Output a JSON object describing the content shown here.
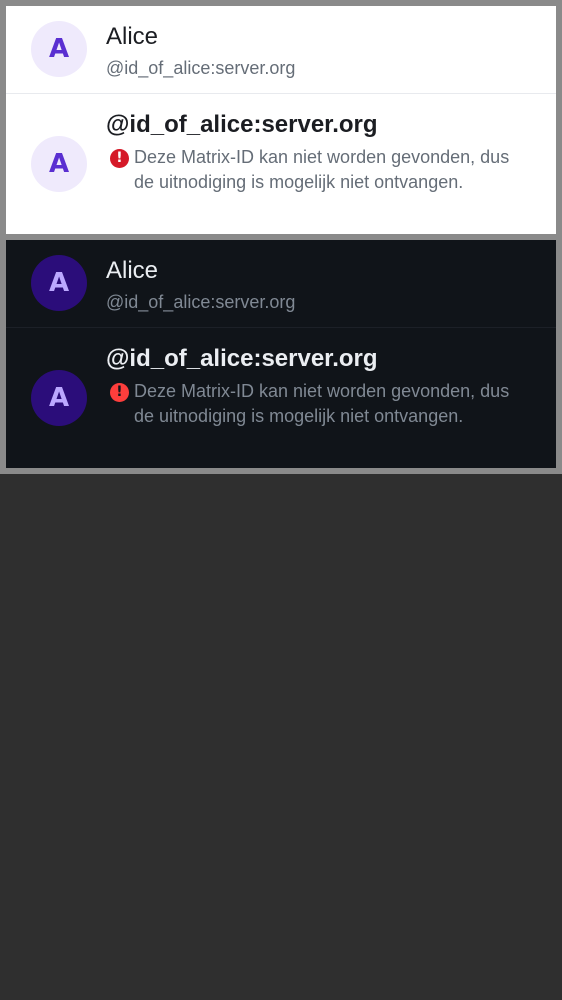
{
  "light_panel": {
    "member_row": {
      "avatar_letter": "A",
      "display_name": "Alice",
      "user_id": "@id_of_alice:server.org"
    },
    "unresolved_row": {
      "avatar_letter": "A",
      "user_id": "@id_of_alice:server.org",
      "warning_icon": "error-icon",
      "warning_text": "Deze Matrix-ID kan niet worden gevonden, dus de uitnodiging is mogelijk niet ontvangen."
    }
  },
  "dark_panel": {
    "member_row": {
      "avatar_letter": "A",
      "display_name": "Alice",
      "user_id": "@id_of_alice:server.org"
    },
    "unresolved_row": {
      "avatar_letter": "A",
      "user_id": "@id_of_alice:server.org",
      "warning_icon": "error-icon",
      "warning_text": "Deze Matrix-ID kan niet worden gevonden, dus de uitnodiging is mogelijk niet ontvangen."
    }
  },
  "colors": {
    "light_avatar_bg": "#efeafc",
    "light_avatar_fg": "#5a2fd1",
    "dark_avatar_bg": "#2b0d7a",
    "dark_avatar_fg": "#bba8ff",
    "light_error": "#d51928",
    "dark_error": "#fd3e3c",
    "dark_surface": "#101419",
    "light_surface": "#ffffff"
  }
}
